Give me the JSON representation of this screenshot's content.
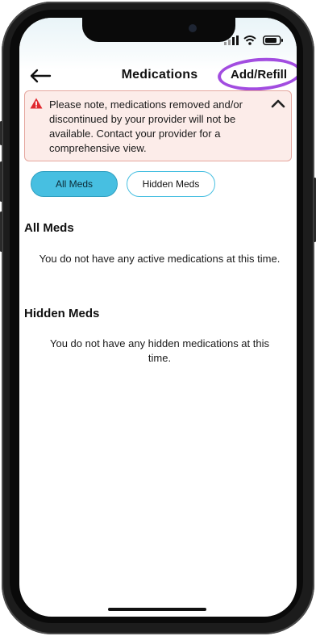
{
  "header": {
    "title": "Medications",
    "add_refill_label": "Add/Refill"
  },
  "alert": {
    "message": "Please note, medications removed and/or discontinued by your provider will not be available. Contact your provider for a comprehensive view."
  },
  "filters": {
    "all_label": "All Meds",
    "hidden_label": "Hidden Meds",
    "selected": "All Meds"
  },
  "sections": {
    "all": {
      "title": "All Meds",
      "empty_message": "You do not have any active medications at this time."
    },
    "hidden": {
      "title": "Hidden Meds",
      "empty_message": "You do not have any hidden medications at this time."
    }
  },
  "colors": {
    "accent": "#47bfe1",
    "alert_bg": "#fcece9",
    "alert_border": "#e5a79f",
    "alert_icon": "#e0282e",
    "annotation": "#a24ce0"
  },
  "icons": [
    "back-arrow-icon",
    "warning-icon",
    "chevron-up-icon",
    "signal-icon",
    "wifi-icon",
    "battery-icon"
  ]
}
